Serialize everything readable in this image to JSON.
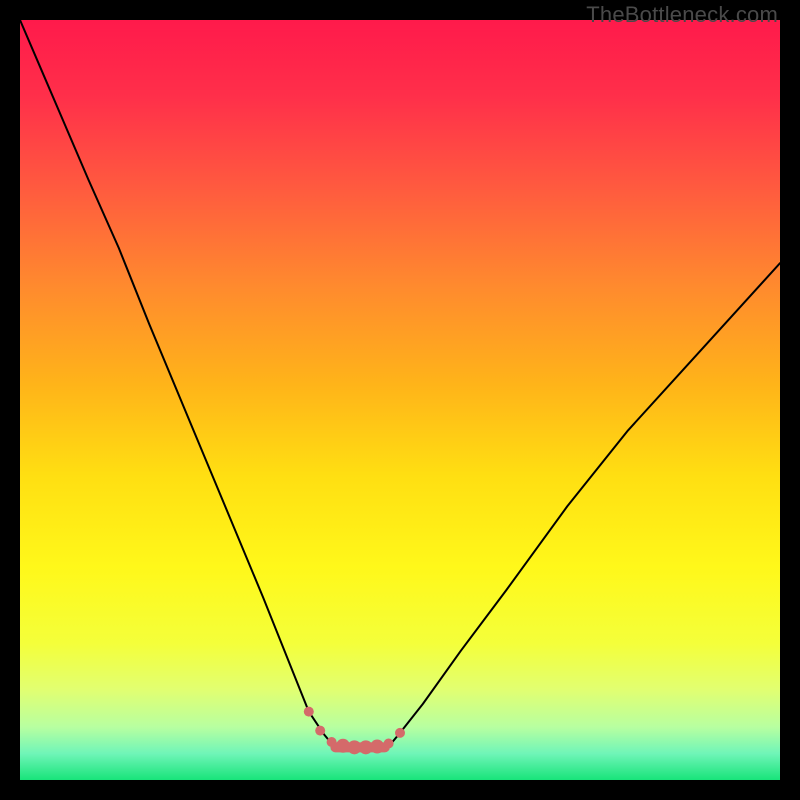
{
  "watermark": "TheBottleneck.com",
  "gradient": {
    "stops": [
      {
        "offset": 0.0,
        "color": "#ff1a4b"
      },
      {
        "offset": 0.1,
        "color": "#ff2f4a"
      },
      {
        "offset": 0.22,
        "color": "#ff5a3f"
      },
      {
        "offset": 0.35,
        "color": "#ff8a2e"
      },
      {
        "offset": 0.48,
        "color": "#ffb419"
      },
      {
        "offset": 0.6,
        "color": "#ffdf12"
      },
      {
        "offset": 0.72,
        "color": "#fff81a"
      },
      {
        "offset": 0.82,
        "color": "#f4ff3a"
      },
      {
        "offset": 0.88,
        "color": "#e2ff70"
      },
      {
        "offset": 0.93,
        "color": "#b8ffa0"
      },
      {
        "offset": 0.965,
        "color": "#70f5b8"
      },
      {
        "offset": 1.0,
        "color": "#18e47a"
      }
    ]
  },
  "chart_data": {
    "type": "line",
    "title": "",
    "xlabel": "",
    "ylabel": "",
    "xlim": [
      0,
      100
    ],
    "ylim": [
      0,
      100
    ],
    "legend": false,
    "grid": false,
    "series": [
      {
        "name": "bottleneck-curve",
        "color": "#000000",
        "width": 2.0,
        "x": [
          0,
          3,
          6,
          9,
          13,
          17,
          22,
          27,
          32,
          36,
          38,
          40,
          41,
          42,
          43,
          44,
          46,
          48,
          49,
          50,
          53,
          58,
          64,
          72,
          80,
          90,
          100
        ],
        "y": [
          100,
          93,
          86,
          79,
          70,
          60,
          48,
          36,
          24,
          14,
          9,
          6,
          4.8,
          4.5,
          4.4,
          4.3,
          4.3,
          4.5,
          5.0,
          6.2,
          10,
          17,
          25,
          36,
          46,
          57,
          68
        ]
      }
    ],
    "markers": {
      "name": "trough-markers",
      "color": "#d46a6a",
      "radius_small": 5,
      "radius_large": 7,
      "points": [
        {
          "x": 38.0,
          "y": 9.0,
          "r": "small"
        },
        {
          "x": 39.5,
          "y": 6.5,
          "r": "small"
        },
        {
          "x": 41.0,
          "y": 5.0,
          "r": "small"
        },
        {
          "x": 42.5,
          "y": 4.5,
          "r": "large"
        },
        {
          "x": 44.0,
          "y": 4.3,
          "r": "large"
        },
        {
          "x": 45.5,
          "y": 4.3,
          "r": "large"
        },
        {
          "x": 47.0,
          "y": 4.4,
          "r": "large"
        },
        {
          "x": 48.5,
          "y": 4.8,
          "r": "small"
        },
        {
          "x": 50.0,
          "y": 6.2,
          "r": "small"
        }
      ]
    },
    "bottom_band": {
      "name": "thick-baseline",
      "color": "#d46a6a",
      "y": 4.3,
      "x0": 41.5,
      "x1": 48.0,
      "thickness": 10
    }
  }
}
